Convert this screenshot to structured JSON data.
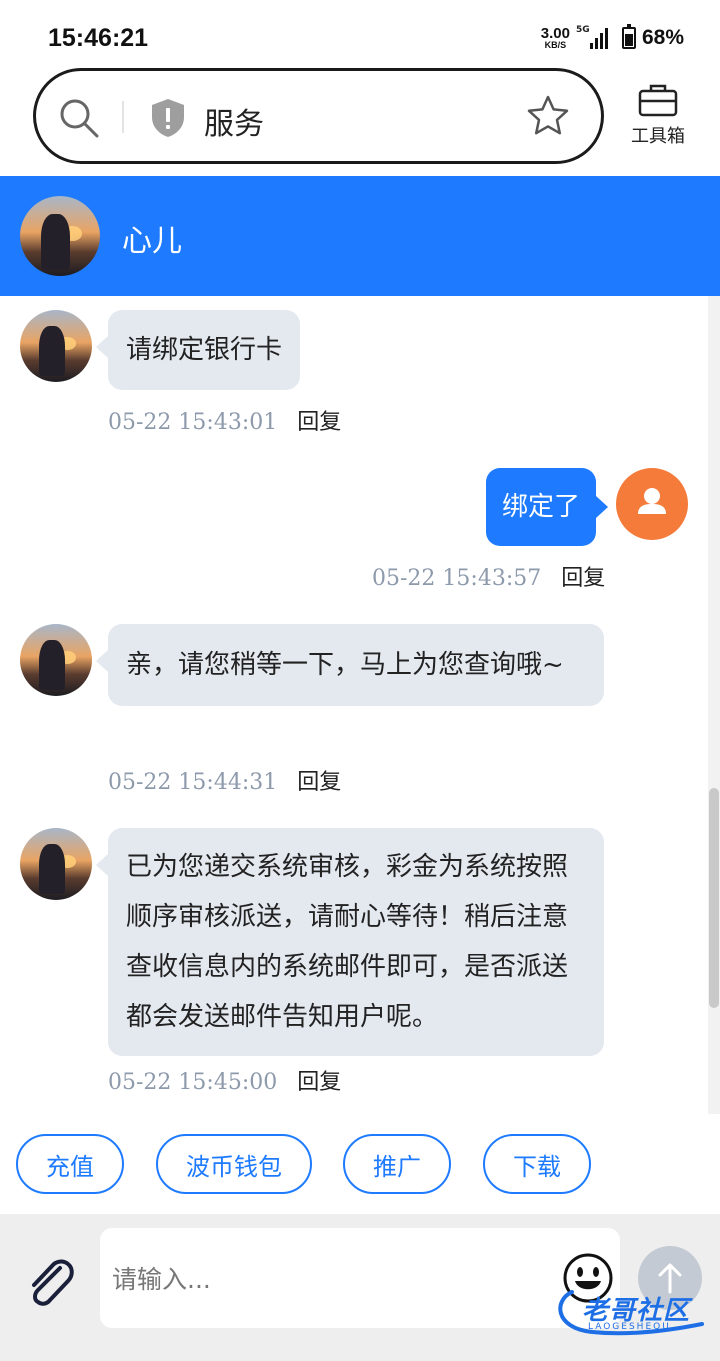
{
  "status_bar": {
    "time": "15:46:21",
    "net_speed_value": "3.00",
    "net_speed_unit": "KB/S",
    "network_type": "5G",
    "battery_percent": "68%",
    "battery_level": 0.68
  },
  "search": {
    "query": "服务",
    "icons": [
      "search-icon",
      "shield-alert-icon",
      "star-icon"
    ]
  },
  "toolbox": {
    "label": "工具箱",
    "icon": "briefcase-icon"
  },
  "chat_header": {
    "contact_name": "心儿"
  },
  "messages": [
    {
      "direction": "incoming",
      "text": "请绑定银行卡",
      "time": "05-22 15:43:01",
      "reply_label": "回复"
    },
    {
      "direction": "outgoing",
      "text": "绑定了",
      "time": "05-22 15:43:57",
      "reply_label": "回复"
    },
    {
      "direction": "incoming",
      "text": "亲，请您稍等一下，马上为您查询哦~",
      "time": "05-22 15:44:31",
      "reply_label": "回复"
    },
    {
      "direction": "incoming",
      "text": "已为您递交系统审核，彩金为系统按照顺序审核派送，请耐心等待！稍后注意查收信息内的系统邮件即可，是否派送都会发送邮件告知用户呢。",
      "time": "05-22 15:45:00",
      "reply_label": "回复"
    }
  ],
  "quick_actions": [
    {
      "label": "充值"
    },
    {
      "label": "波币钱包"
    },
    {
      "label": "推广"
    },
    {
      "label": "下载"
    }
  ],
  "composer": {
    "placeholder": "请输入...",
    "icons": [
      "paperclip-icon",
      "emoji-icon",
      "send-arrow-icon"
    ]
  },
  "watermark": {
    "text": "老哥社区",
    "sub": "LAOGESHEQU"
  },
  "colors": {
    "accent": "#1e7bff",
    "incoming_bubble": "#e4e9f0",
    "user_avatar": "#f57b3a",
    "timestamp": "#8d9aab"
  }
}
